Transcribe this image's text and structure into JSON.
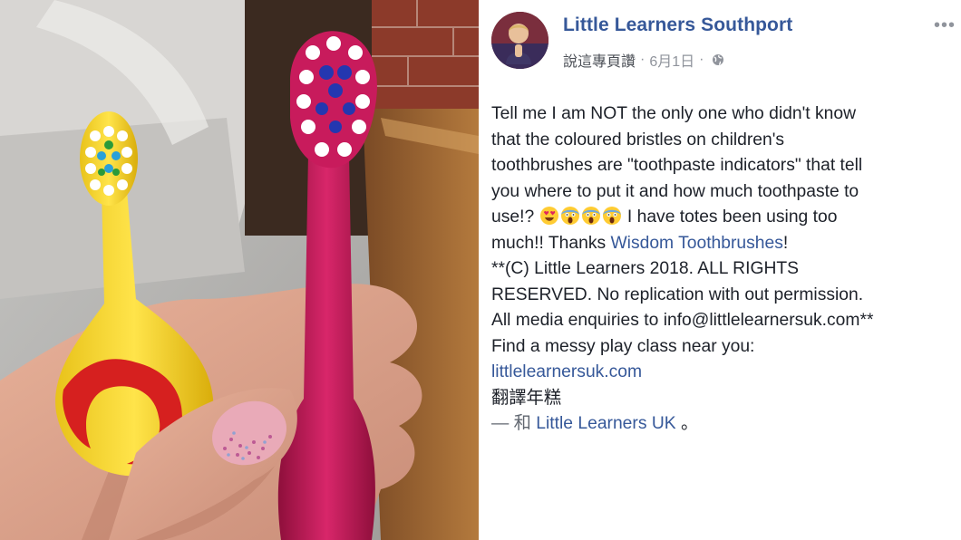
{
  "post": {
    "page_name": "Little Learners Southport",
    "like_page": "說這專頁讚",
    "separator": "·",
    "date": "6月1日",
    "more": "•••",
    "text": {
      "line1": "Tell me I am NOT the only one who didn't know",
      "line2": "that the coloured bristles on children's",
      "line3": "toothbrushes are \"toothpaste indicators\" that tell",
      "line4": "you where to put it and how much toothpaste to",
      "line5_a": "use!? ",
      "line5_b": " I have totes been using too",
      "line6_a": "much!! Thanks ",
      "line6_link": "Wisdom Toothbrushes",
      "line6_b": "!",
      "line7": "**(C) Little Learners 2018. ALL RIGHTS",
      "line8": "RESERVED. No replication with out permission.",
      "line9": "All media enquiries to info@littlelearnersuk.com**",
      "line10": "Find a messy play class near you:",
      "line11_link": "littlelearnersuk.com",
      "translate": "翻譯年糕",
      "with_prefix": "— 和 ",
      "with_link": "Little Learners UK",
      "with_suffix": " 。"
    },
    "emojis": [
      "heart-eyes-emoji",
      "screaming-face-emoji",
      "screaming-face-emoji",
      "screaming-face-emoji"
    ],
    "link_color": "#365899",
    "text_color": "#1d2129",
    "meta_color": "#90949c"
  }
}
